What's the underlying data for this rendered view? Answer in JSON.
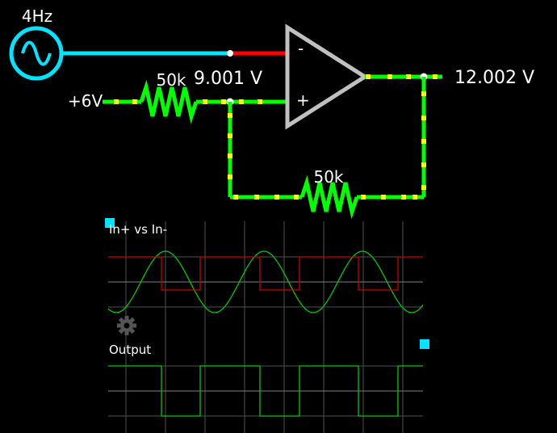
{
  "circuit": {
    "source_frequency": "4Hz",
    "input_voltage": "+6V",
    "resistor_input": "50k",
    "resistor_feedback": "50k",
    "node_voltage": "9.001 V",
    "output_voltage": "12.002 V",
    "opamp_minus": "-",
    "opamp_plus": "+"
  },
  "scopes": {
    "top_label": "In+ vs In-",
    "bottom_label": "Output"
  },
  "colors": {
    "wire_source": "#00e5ff",
    "wire_negative": "#ff0000",
    "wire_active": "#00ff00",
    "current_dot": "#ffff00",
    "opamp": "#c0c0c0",
    "grid": "#505050",
    "trace_sine": "#00cc00",
    "trace_square": "#cc0000",
    "handle": "#00e5ff"
  },
  "icons": {
    "source": "sine-wave-source-icon",
    "settings": "gear-icon"
  }
}
